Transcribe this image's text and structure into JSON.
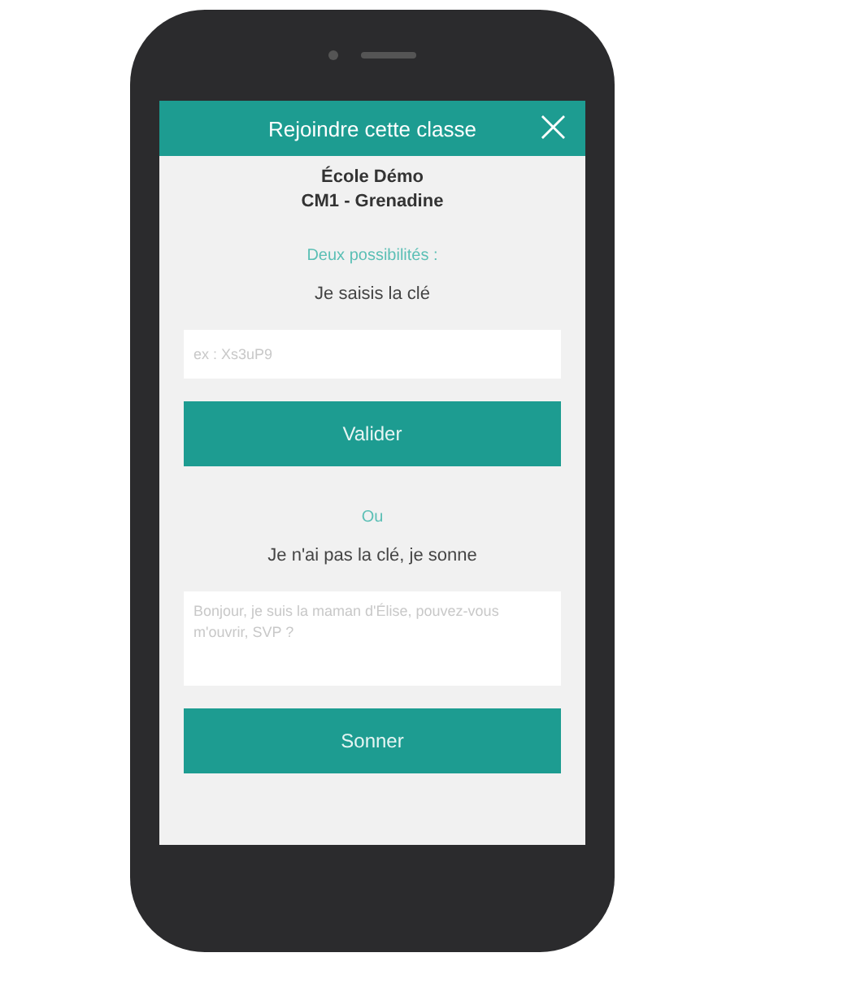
{
  "header": {
    "title": "Rejoindre cette classe",
    "close": "×"
  },
  "school": {
    "name": "École Démo",
    "class": "CM1 - Grenadine"
  },
  "intro": "Deux possibilités :",
  "key_section": {
    "label": "Je saisis la clé",
    "placeholder": "ex : Xs3uP9",
    "button": "Valider"
  },
  "separator": "Ou",
  "ring_section": {
    "label": "Je n'ai pas la clé, je sonne",
    "placeholder": "Bonjour, je suis la maman d'Élise, pouvez-vous m'ouvrir, SVP ?",
    "button": "Sonner"
  }
}
